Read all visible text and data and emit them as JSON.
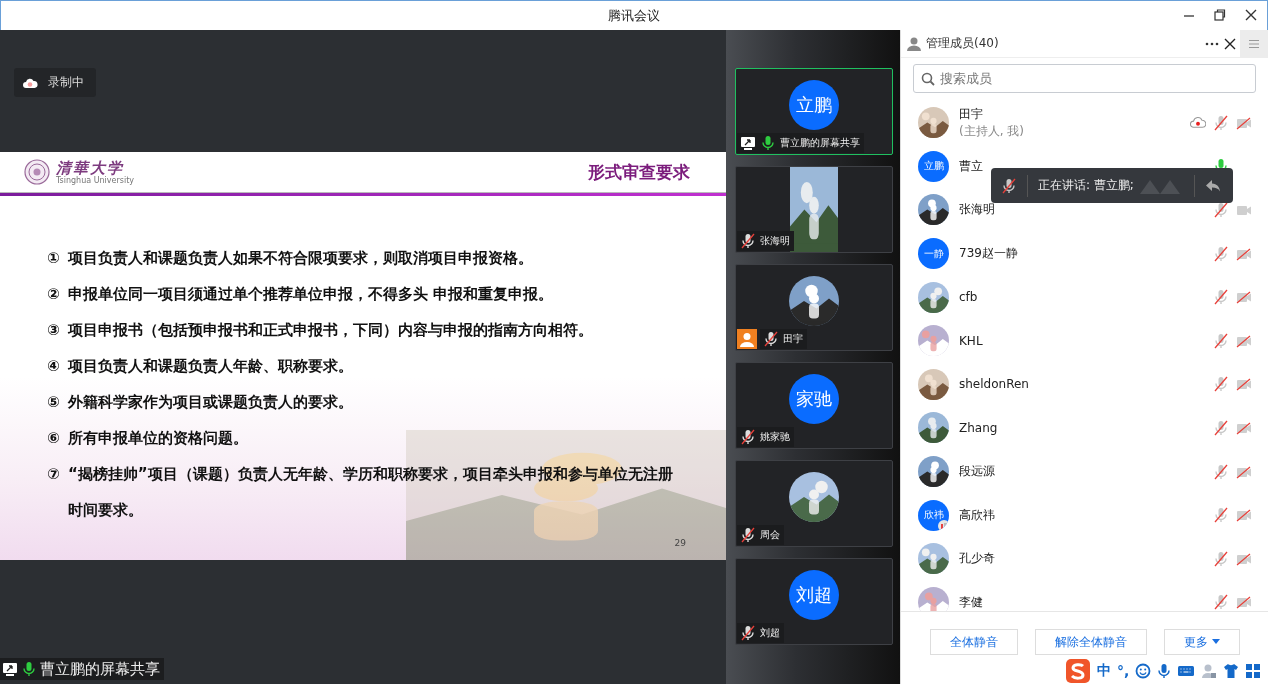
{
  "window": {
    "title": "腾讯会议"
  },
  "recording": {
    "label": "录制中"
  },
  "slide": {
    "logo_name": "清華大学",
    "logo_subtitle": "Tsinghua University",
    "title": "形式审查要求",
    "page": "29",
    "items": [
      {
        "number": "①",
        "text": "项目负责人和课题负责人如果不符合限项要求，则取消项目申报资格。"
      },
      {
        "number": "②",
        "text": "申报单位同一项目须通过单个推荐单位申报，不得多头 申报和重复申报。"
      },
      {
        "number": "③",
        "text": "项目申报书（包括预申报书和正式申报书，下同）内容与申报的指南方向相符。"
      },
      {
        "number": "④",
        "text": "项目负责人和课题负责人年龄、职称要求。"
      },
      {
        "number": "⑤",
        "text": "外籍科学家作为项目或课题负责人的要求。"
      },
      {
        "number": "⑥",
        "text": "所有申报单位的资格问题。"
      },
      {
        "number": "⑦",
        "text": "“揭榜挂帅”项目（课题）负责人无年龄、学历和职称要求，项目牵头申报和参与单位无注册时间要求。"
      }
    ]
  },
  "share_label": {
    "text": "曹立鹏的屏幕共享",
    "muted": false
  },
  "video_tiles": [
    {
      "kind": "avatar",
      "avatar_text": "立鹏",
      "name": "曹立鹏的屏幕共享",
      "muted": false,
      "sharing": true,
      "host": false,
      "selected": true
    },
    {
      "kind": "video",
      "name": "张海明",
      "muted": true,
      "sharing": false,
      "host": false,
      "selected": false
    },
    {
      "name": "田宇",
      "muted": true,
      "sharing": false,
      "host": true,
      "selected": false
    },
    {
      "kind": "avatar",
      "avatar_text": "家驰",
      "name": "姚家驰",
      "muted": true,
      "sharing": false,
      "host": false,
      "selected": false
    },
    {
      "name": "周会",
      "muted": true,
      "sharing": false,
      "host": false,
      "selected": false
    },
    {
      "kind": "avatar",
      "avatar_text": "刘超",
      "name": "刘超",
      "muted": true,
      "sharing": false,
      "host": false,
      "selected": false
    }
  ],
  "members_panel": {
    "title": "管理成员(40)",
    "search": {
      "placeholder": "搜索成员"
    },
    "members": [
      {
        "name": "田宇",
        "note": "(主持人, 我)",
        "recording": true,
        "muted": true,
        "camera_off": true,
        "phone": false
      },
      {
        "name": "曹立",
        "avatar": {
          "kind": "text",
          "text": "立鹏"
        },
        "recording": false,
        "muted": false,
        "phone": false
      },
      {
        "name": "张海明",
        "recording": false,
        "muted": true,
        "camera_off": false,
        "phone": false
      },
      {
        "name": "739赵一静",
        "avatar": {
          "kind": "text",
          "text": "一静"
        },
        "recording": false,
        "muted": true,
        "camera_off": true,
        "phone": false
      },
      {
        "name": "cfb",
        "recording": false,
        "muted": true,
        "camera_off": true,
        "phone": false
      },
      {
        "name": "KHL",
        "recording": false,
        "muted": true,
        "camera_off": true,
        "phone": false
      },
      {
        "name": "sheldonRen",
        "recording": false,
        "muted": true,
        "camera_off": true,
        "phone": false
      },
      {
        "name": "Zhang",
        "recording": false,
        "muted": true,
        "camera_off": true,
        "phone": false
      },
      {
        "name": "段远源",
        "recording": false,
        "muted": true,
        "camera_off": true,
        "phone": false
      },
      {
        "name": "高欣祎",
        "avatar": {
          "kind": "text",
          "text": "欣祎"
        },
        "recording": false,
        "muted": true,
        "camera_off": true,
        "phone": true
      },
      {
        "name": "孔少奇",
        "recording": false,
        "muted": true,
        "camera_off": true,
        "phone": false
      },
      {
        "name": "李健",
        "recording": false,
        "muted": true,
        "camera_off": true,
        "phone": false
      }
    ],
    "speaking_tip": {
      "text": "正在讲话: 曹立鹏;"
    },
    "buttons": [
      {
        "label": "全体静音",
        "dropdown": false
      },
      {
        "label": "解除全体静音",
        "dropdown": false
      },
      {
        "label": "更多",
        "dropdown": true
      }
    ]
  },
  "ime_bar": {
    "items": [
      {
        "kind": "text",
        "text": "中"
      },
      {
        "kind": "text",
        "text": "°,"
      }
    ]
  }
}
